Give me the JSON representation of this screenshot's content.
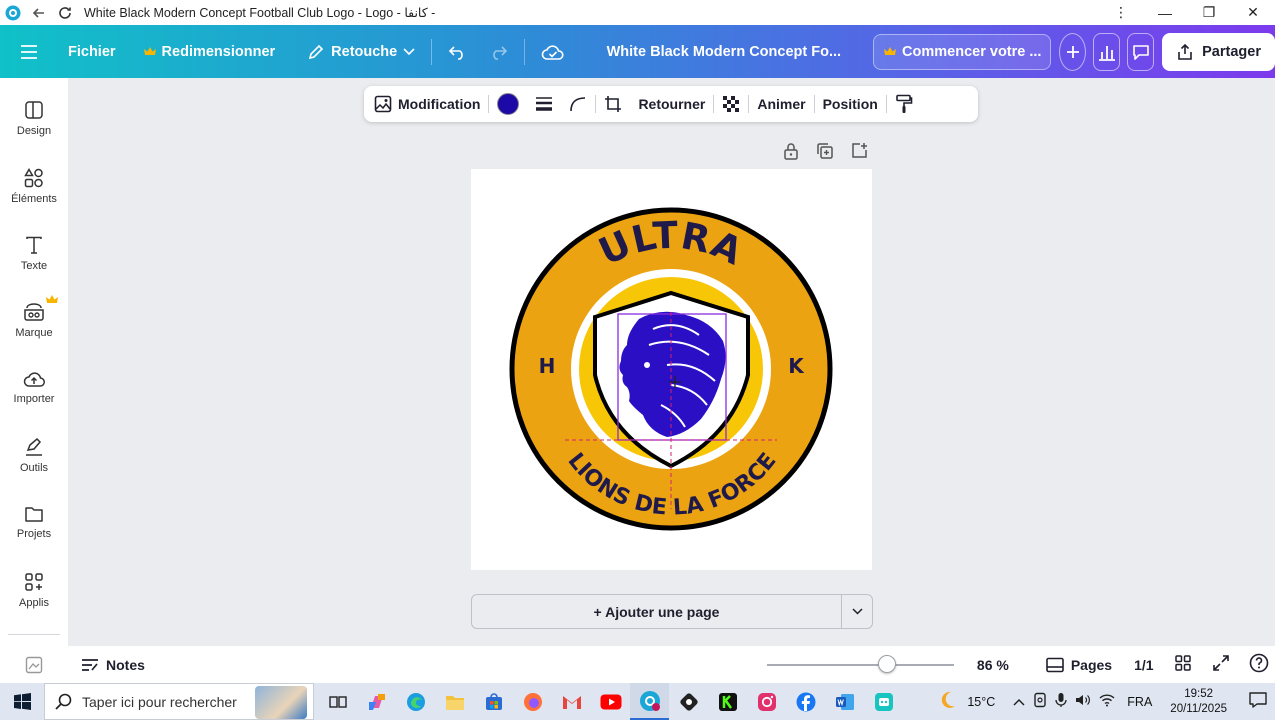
{
  "window": {
    "title": "White Black Modern Concept Football Club Logo - Logo - كانفا -",
    "controls": {
      "minimize": "—",
      "maximize": "❐",
      "close": "✕"
    }
  },
  "header": {
    "file": "Fichier",
    "resize": "Redimensionner",
    "edit": "Retouche",
    "doc_title": "White Black Modern Concept Fo...",
    "trial": "Commencer votre ...",
    "share": "Partager"
  },
  "sidebar": {
    "items": [
      {
        "label": "Design",
        "icon": "layout-icon"
      },
      {
        "label": "Éléments",
        "icon": "shapes-icon"
      },
      {
        "label": "Texte",
        "icon": "text-icon"
      },
      {
        "label": "Marque",
        "icon": "brand-icon"
      },
      {
        "label": "Importer",
        "icon": "cloud-upload-icon"
      },
      {
        "label": "Outils",
        "icon": "pen-icon"
      },
      {
        "label": "Projets",
        "icon": "folder-icon"
      },
      {
        "label": "Applis",
        "icon": "apps-icon"
      }
    ]
  },
  "toolbar": {
    "edit": "Modification",
    "color": "#1d0aa6",
    "flip": "Retourner",
    "animate": "Animer",
    "position": "Position"
  },
  "logo": {
    "top_text": "ULTRA",
    "left_letter": "H",
    "right_letter": "K",
    "bottom_text": "LIONS DE LA FORCE",
    "ring_color": "#eca312",
    "inner_color": "#f7c707",
    "lion_color": "#2a0fc4"
  },
  "canvas": {
    "add_page": "+ Ajouter une page"
  },
  "bottom": {
    "notes": "Notes",
    "zoom_level": 0.66,
    "zoom_text": "86 %",
    "pages_label": "Pages",
    "page_count": "1/1"
  },
  "taskbar": {
    "search_placeholder": "Taper ici pour rechercher",
    "weather": "15°C",
    "language": "FRA",
    "time": "19:52",
    "date": "20/11/2025"
  }
}
